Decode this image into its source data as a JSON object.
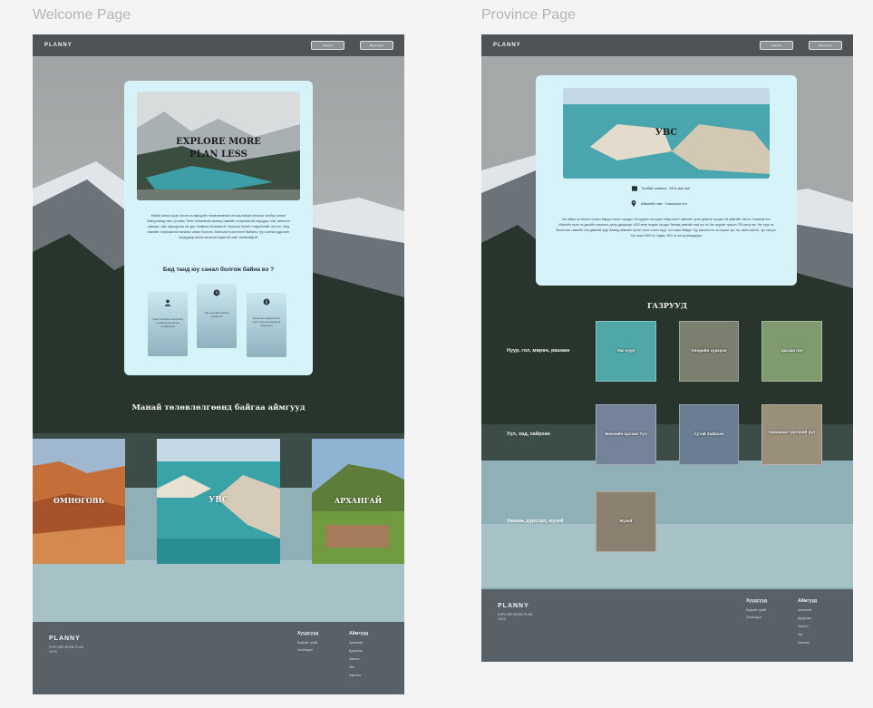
{
  "canvas_labels": {
    "welcome": "Welcome Page",
    "province": "Province Page"
  },
  "nav": {
    "logo": "PLANNY",
    "btn1": "Нэвтрэх",
    "btn2": "Бүртгүүлэх"
  },
  "welcome": {
    "hero_line1": "EXPLORE MORE",
    "hero_line2": "PLAN LESS",
    "intro": "Манай аялал зураг хэлхээ нь өөрсдийн төлөвлөгөөгөө сэтгэлд нийцэх аялалыг хялбар зохион байгуулахад тань туслана. Таны төлөвлөсөн аялалд хамгийн тохиромжтой газруудыг олж, аялалын хуваарь, зам, маршрутаа нэг дор төлөвлөх боломжтой. Аялалын бүхий л мэдээллийг нэгтгэн, танд хамгийн тохиромжтой аялалыг санал болгоно. Монголын үзэсгэлэнт байгаль, түүх соёлын дурсгалт газруудаар аялах аялалаа бидэнтэй хамт төлөвлөөрэй.",
    "question": "Бид танд юу санал болгож байна вэ ?",
    "features": [
      {
        "icon": "user-icon",
        "text": "Хэрэглэгчийн сонирхолд тохирсон аялалын төлөвлөгөө"
      },
      {
        "icon": "clock-icon",
        "text": "Цаг хугацаа хэмнэх гүйцэтгэл"
      },
      {
        "icon": "info-icon",
        "text": "Аялалын мэдээллийг нэгтгэсэн дэлгэрэнгүй мэдээлэл"
      }
    ],
    "section_title": "Манай төлөвлөлгөөнд байгаа аймгууд",
    "provinces": [
      "ӨМНӨГОВЬ",
      "УВС",
      "АРХАНГАЙ"
    ],
    "footer": {
      "logo": "PLANNY",
      "tagline": "EXPLORE MORE PLAN LESS",
      "col1_title": "Хуудсууд",
      "col1_items": [
        "Бидний тухай",
        "Холбогдох"
      ],
      "col2_title": "Аймгууд",
      "col2_items": [
        "Архангай",
        "Дундговь",
        "Завхан",
        "Увс",
        "Хөвсгөл"
      ]
    }
  },
  "province": {
    "name": "УВС",
    "area_label": "Талбай хэмжээ : 69.6 мян.км²",
    "center_label": "Аймгийн төв : Улаангом хот",
    "description": "Увс аймаг нь Монгол улсын баруун хэсэгт оршдог. Их нуурын хотгорын хойд хэсэгт аймгийн нутаг дэвсгэр оршдог ба аймгийн төв нь Улаангом хот. Аймгийн нутаг нь далайн түвшнээс дээш дунджаар 1400 метр өндөрт оршдог бөгөөд хамгийн нам цэг нь Увс нуурын түвшин 759 метр юм. Увс нуур нь Монголын хамгийн том давстай нуур бөгөөд аймгийн нутагт олон тооны нуур, гол горхи байдаг. Уур амьсгал нь эх газрын эрс тэс, өвөл хүйтэн, зун сэрүүн. Хүн амын 65% нь хөдөө, 35% нь хотод амьдардаг.",
    "gallery_title": "ГАЗРУУД",
    "rows": [
      {
        "label": "Нуур, гол, мөрөн, рашаан",
        "items": [
          "Увс нуур",
          "Хөндийн хүрхрээ",
          "Цагаан гол"
        ]
      },
      {
        "label": "Уул, хад, хайрхан",
        "items": [
          "Мөнхийн Цагаан Уул",
          "Сутай Хайрхан",
          "Хархираа түргэний уул"
        ]
      },
      {
        "label": "Хөшөө, дурсгал, музей",
        "items": [
          "Музей"
        ]
      }
    ],
    "footer": {
      "logo": "PLANNY",
      "tagline": "EXPLORE MORE PLAN LESS",
      "col1_title": "Хуудсууд",
      "col1_items": [
        "Бидний тухай",
        "Холбогдох"
      ],
      "col2_title": "Аймгууд",
      "col2_items": [
        "Архангай",
        "Дундговь",
        "Завхан",
        "Увс",
        "Хөвсгөл"
      ]
    }
  }
}
